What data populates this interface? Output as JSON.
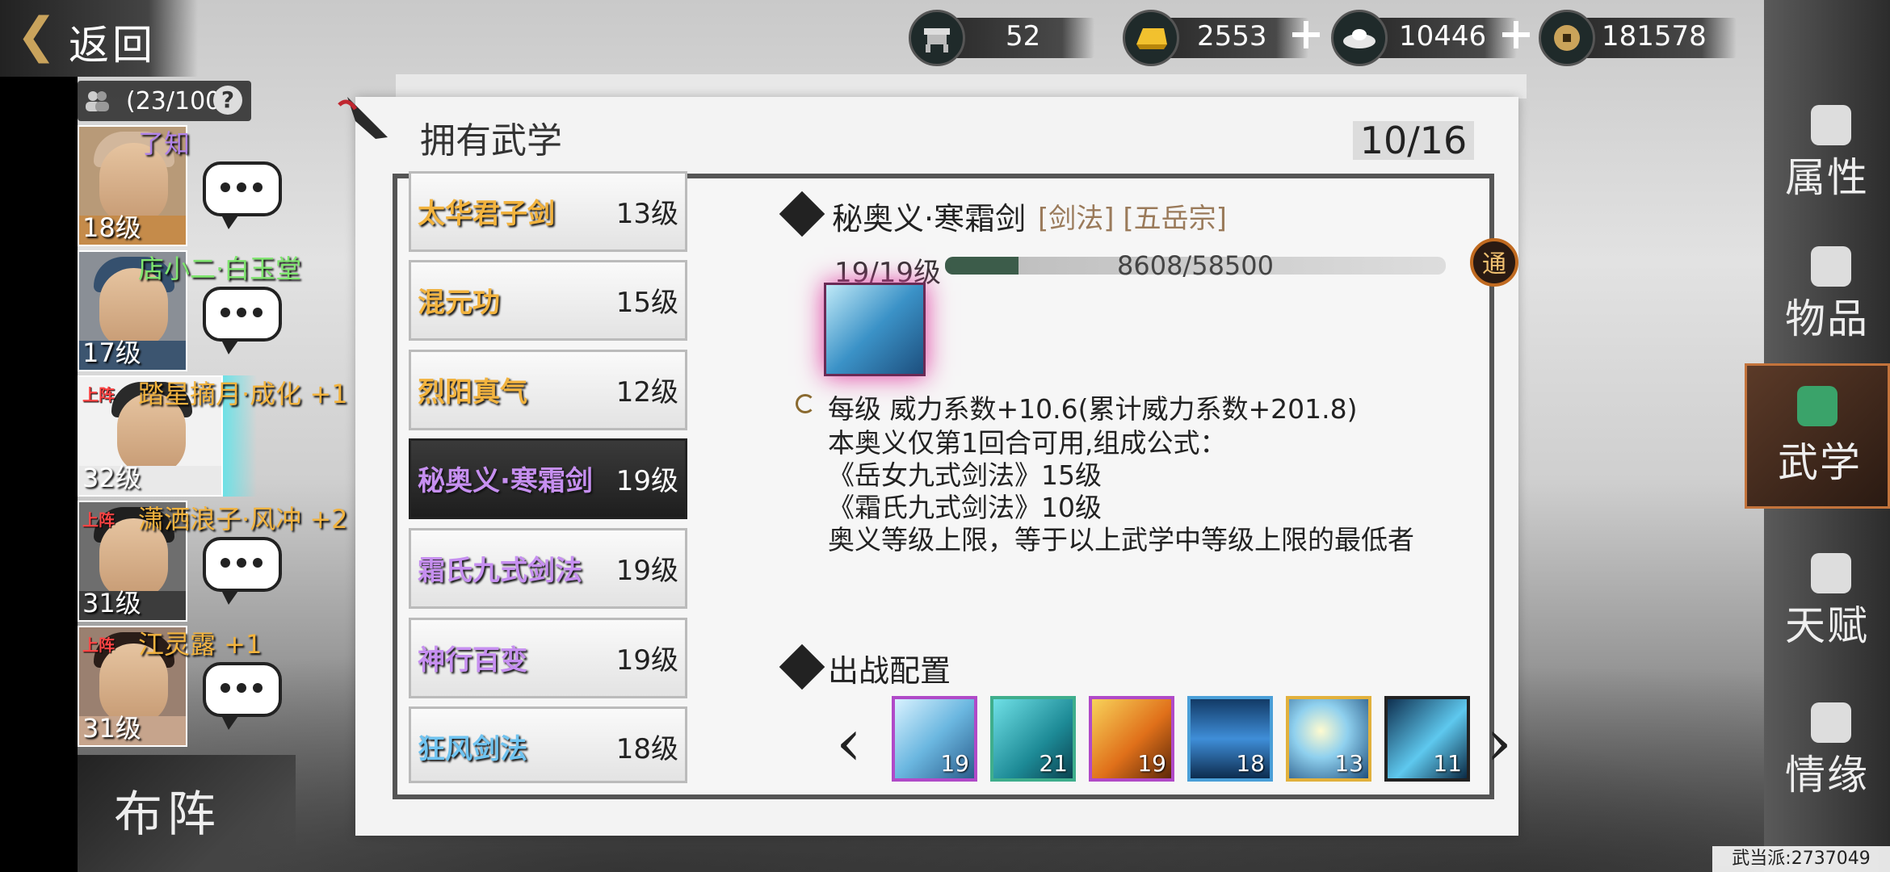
{
  "header": {
    "back_label": "返回",
    "capacity": "(23/100",
    "help": "?"
  },
  "characters": [
    {
      "name": "了知",
      "level": "18级",
      "tag": "",
      "name_color": "#b083e8"
    },
    {
      "name": "店小二·白玉堂",
      "level": "17级",
      "tag": "",
      "name_color": "#7ee56e"
    },
    {
      "name": "踏星摘月·成化 +1",
      "level": "32级",
      "tag": "上阵",
      "name_color": "#f2b33e"
    },
    {
      "name": "潇洒浪子·风冲 +2",
      "level": "31级",
      "tag": "上阵",
      "name_color": "#f2b33e"
    },
    {
      "name": "江灵露 +1",
      "level": "31级",
      "tag": "上阵",
      "name_color": "#f2b33e"
    }
  ],
  "formation_label": "布阵",
  "currency": [
    {
      "icon": "anvil-icon",
      "value": "52"
    },
    {
      "icon": "gold-ingot-icon",
      "value": "2553"
    },
    {
      "icon": "silver-ingot-icon",
      "value": "10446"
    },
    {
      "icon": "coin-icon",
      "value": "181578"
    }
  ],
  "panel": {
    "title": "拥有武学",
    "count": "10/16"
  },
  "skills": [
    {
      "name": "太华君子剑",
      "level": "13级",
      "color": "#f2b33e"
    },
    {
      "name": "混元功",
      "level": "15级",
      "color": "#f2b33e"
    },
    {
      "name": "烈阳真气",
      "level": "12级",
      "color": "#f2b33e"
    },
    {
      "name": "秘奥义·寒霜剑",
      "level": "19级",
      "color": "#c68ff0"
    },
    {
      "name": "霜氏九式剑法",
      "level": "19级",
      "color": "#c68ff0"
    },
    {
      "name": "神行百变",
      "level": "19级",
      "color": "#c68ff0"
    },
    {
      "name": "狂风剑法",
      "level": "18级",
      "color": "#6fc3f0"
    }
  ],
  "detail": {
    "name": "秘奥义·寒霜剑",
    "tags": "[剑法] [五岳宗]",
    "level": "19/19级",
    "exp_text": "8608/58500",
    "exp_fraction": 0.147,
    "tong": "通",
    "desc_lines": [
      "每级    威力系数+10.6(累计威力系数+201.8)",
      "本奥义仅第1回合可用,组成公式：",
      "《岳女九式剑法》15级",
      "《霜氏九式剑法》10级",
      "奥义等级上限，等于以上武学中等级上限的最低者"
    ]
  },
  "battle": {
    "title": "出战配置",
    "slots": [
      {
        "level": "19",
        "border": "#b04ac8"
      },
      {
        "level": "21",
        "border": "#3fae8c"
      },
      {
        "level": "19",
        "border": "#b04ac8"
      },
      {
        "level": "18",
        "border": "#4a9fd8"
      },
      {
        "level": "13",
        "border": "#e2b13c"
      },
      {
        "level": "11",
        "border": "#222222"
      }
    ]
  },
  "tabs": [
    {
      "label": "属性",
      "icon": "rat-icon"
    },
    {
      "label": "物品",
      "icon": "gift-box-icon"
    },
    {
      "label": "武学",
      "icon": "book-icon"
    },
    {
      "label": "天赋",
      "icon": "talent-icon"
    },
    {
      "label": "情缘",
      "icon": "heart-icon"
    }
  ],
  "footer": "武当派:2737049"
}
